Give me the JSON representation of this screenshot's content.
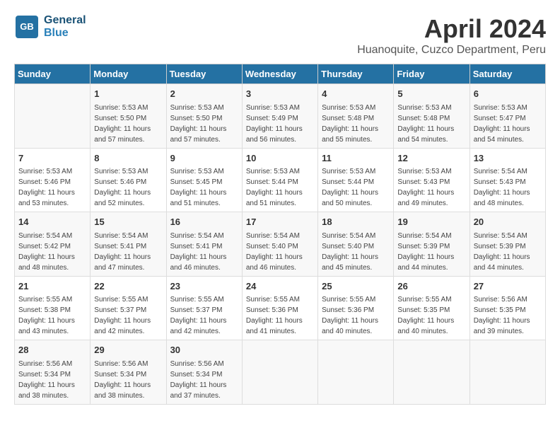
{
  "logo": {
    "line1": "General",
    "line2": "Blue"
  },
  "title": "April 2024",
  "subtitle": "Huanoquite, Cuzco Department, Peru",
  "columns": [
    "Sunday",
    "Monday",
    "Tuesday",
    "Wednesday",
    "Thursday",
    "Friday",
    "Saturday"
  ],
  "weeks": [
    [
      {
        "day": "",
        "info": ""
      },
      {
        "day": "1",
        "info": "Sunrise: 5:53 AM\nSunset: 5:50 PM\nDaylight: 11 hours\nand 57 minutes."
      },
      {
        "day": "2",
        "info": "Sunrise: 5:53 AM\nSunset: 5:50 PM\nDaylight: 11 hours\nand 57 minutes."
      },
      {
        "day": "3",
        "info": "Sunrise: 5:53 AM\nSunset: 5:49 PM\nDaylight: 11 hours\nand 56 minutes."
      },
      {
        "day": "4",
        "info": "Sunrise: 5:53 AM\nSunset: 5:48 PM\nDaylight: 11 hours\nand 55 minutes."
      },
      {
        "day": "5",
        "info": "Sunrise: 5:53 AM\nSunset: 5:48 PM\nDaylight: 11 hours\nand 54 minutes."
      },
      {
        "day": "6",
        "info": "Sunrise: 5:53 AM\nSunset: 5:47 PM\nDaylight: 11 hours\nand 54 minutes."
      }
    ],
    [
      {
        "day": "7",
        "info": "Sunrise: 5:53 AM\nSunset: 5:46 PM\nDaylight: 11 hours\nand 53 minutes."
      },
      {
        "day": "8",
        "info": "Sunrise: 5:53 AM\nSunset: 5:46 PM\nDaylight: 11 hours\nand 52 minutes."
      },
      {
        "day": "9",
        "info": "Sunrise: 5:53 AM\nSunset: 5:45 PM\nDaylight: 11 hours\nand 51 minutes."
      },
      {
        "day": "10",
        "info": "Sunrise: 5:53 AM\nSunset: 5:44 PM\nDaylight: 11 hours\nand 51 minutes."
      },
      {
        "day": "11",
        "info": "Sunrise: 5:53 AM\nSunset: 5:44 PM\nDaylight: 11 hours\nand 50 minutes."
      },
      {
        "day": "12",
        "info": "Sunrise: 5:53 AM\nSunset: 5:43 PM\nDaylight: 11 hours\nand 49 minutes."
      },
      {
        "day": "13",
        "info": "Sunrise: 5:54 AM\nSunset: 5:43 PM\nDaylight: 11 hours\nand 48 minutes."
      }
    ],
    [
      {
        "day": "14",
        "info": "Sunrise: 5:54 AM\nSunset: 5:42 PM\nDaylight: 11 hours\nand 48 minutes."
      },
      {
        "day": "15",
        "info": "Sunrise: 5:54 AM\nSunset: 5:41 PM\nDaylight: 11 hours\nand 47 minutes."
      },
      {
        "day": "16",
        "info": "Sunrise: 5:54 AM\nSunset: 5:41 PM\nDaylight: 11 hours\nand 46 minutes."
      },
      {
        "day": "17",
        "info": "Sunrise: 5:54 AM\nSunset: 5:40 PM\nDaylight: 11 hours\nand 46 minutes."
      },
      {
        "day": "18",
        "info": "Sunrise: 5:54 AM\nSunset: 5:40 PM\nDaylight: 11 hours\nand 45 minutes."
      },
      {
        "day": "19",
        "info": "Sunrise: 5:54 AM\nSunset: 5:39 PM\nDaylight: 11 hours\nand 44 minutes."
      },
      {
        "day": "20",
        "info": "Sunrise: 5:54 AM\nSunset: 5:39 PM\nDaylight: 11 hours\nand 44 minutes."
      }
    ],
    [
      {
        "day": "21",
        "info": "Sunrise: 5:55 AM\nSunset: 5:38 PM\nDaylight: 11 hours\nand 43 minutes."
      },
      {
        "day": "22",
        "info": "Sunrise: 5:55 AM\nSunset: 5:37 PM\nDaylight: 11 hours\nand 42 minutes."
      },
      {
        "day": "23",
        "info": "Sunrise: 5:55 AM\nSunset: 5:37 PM\nDaylight: 11 hours\nand 42 minutes."
      },
      {
        "day": "24",
        "info": "Sunrise: 5:55 AM\nSunset: 5:36 PM\nDaylight: 11 hours\nand 41 minutes."
      },
      {
        "day": "25",
        "info": "Sunrise: 5:55 AM\nSunset: 5:36 PM\nDaylight: 11 hours\nand 40 minutes."
      },
      {
        "day": "26",
        "info": "Sunrise: 5:55 AM\nSunset: 5:35 PM\nDaylight: 11 hours\nand 40 minutes."
      },
      {
        "day": "27",
        "info": "Sunrise: 5:56 AM\nSunset: 5:35 PM\nDaylight: 11 hours\nand 39 minutes."
      }
    ],
    [
      {
        "day": "28",
        "info": "Sunrise: 5:56 AM\nSunset: 5:34 PM\nDaylight: 11 hours\nand 38 minutes."
      },
      {
        "day": "29",
        "info": "Sunrise: 5:56 AM\nSunset: 5:34 PM\nDaylight: 11 hours\nand 38 minutes."
      },
      {
        "day": "30",
        "info": "Sunrise: 5:56 AM\nSunset: 5:34 PM\nDaylight: 11 hours\nand 37 minutes."
      },
      {
        "day": "",
        "info": ""
      },
      {
        "day": "",
        "info": ""
      },
      {
        "day": "",
        "info": ""
      },
      {
        "day": "",
        "info": ""
      }
    ]
  ]
}
